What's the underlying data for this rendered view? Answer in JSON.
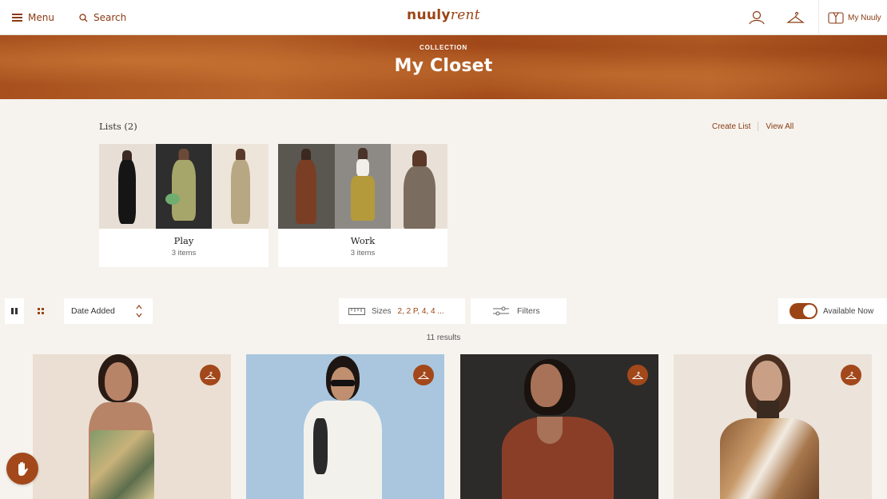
{
  "header": {
    "menu_label": "Menu",
    "search_label": "Search",
    "logo_bold": "nuuly",
    "logo_italic": "rent",
    "my_nuuly_label": "My Nuuly"
  },
  "banner": {
    "kicker": "COLLECTION",
    "title": "My Closet"
  },
  "lists": {
    "heading": "Lists (2)",
    "create_label": "Create List",
    "view_all_label": "View All",
    "items": [
      {
        "name": "Play",
        "count": "3 items"
      },
      {
        "name": "Work",
        "count": "3 items"
      }
    ]
  },
  "toolbar": {
    "sort_label": "Date Added",
    "sizes_label": "Sizes",
    "sizes_value": "2, 2 P, 4, 4 ...",
    "filters_label": "Filters",
    "available_label": "Available Now",
    "available_on": true
  },
  "results": {
    "count_label": "11 results"
  },
  "colors": {
    "brand": "#9b4416",
    "banner": "#a8501e",
    "background": "#f6f3ee"
  },
  "icons": [
    "hamburger-icon",
    "search-icon",
    "user-icon",
    "hanger-icon",
    "closet-icon",
    "list-view-icon",
    "grid-view-icon",
    "sort-arrows-icon",
    "ruler-icon",
    "sliders-icon",
    "help-hand-icon"
  ]
}
